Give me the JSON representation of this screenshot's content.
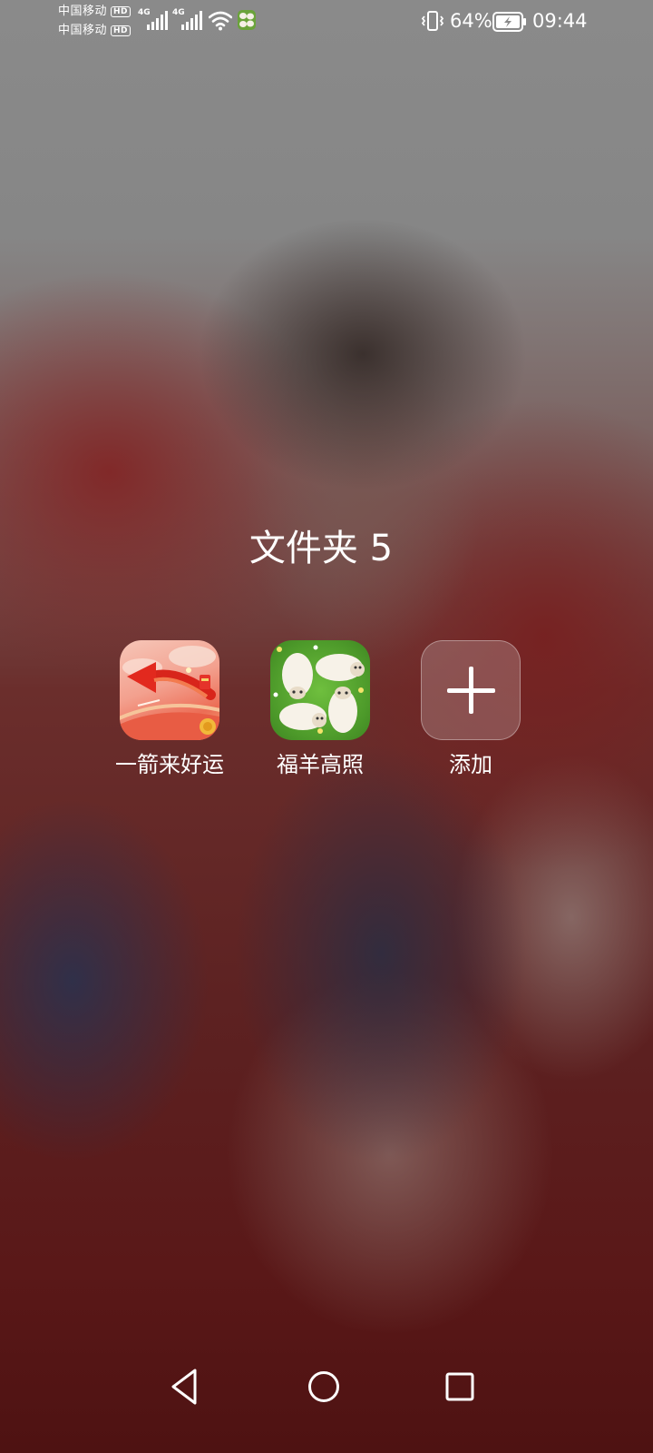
{
  "status_bar": {
    "carrier_1": "中国移动",
    "carrier_2": "中国移动",
    "hd_badge": "HD",
    "network_type_1": "4G",
    "network_type_2": "4G",
    "battery_percent": "64%",
    "time": "09:44"
  },
  "folder": {
    "title": "文件夹 5",
    "apps": [
      {
        "label": "一箭来好运",
        "icon": "red-arrow-icon"
      },
      {
        "label": "福羊高照",
        "icon": "sheep-icon"
      }
    ],
    "add_label": "添加"
  },
  "nav_bar": {
    "back_icon": "back-triangle-icon",
    "home_icon": "home-circle-icon",
    "recent_icon": "recent-square-icon"
  }
}
